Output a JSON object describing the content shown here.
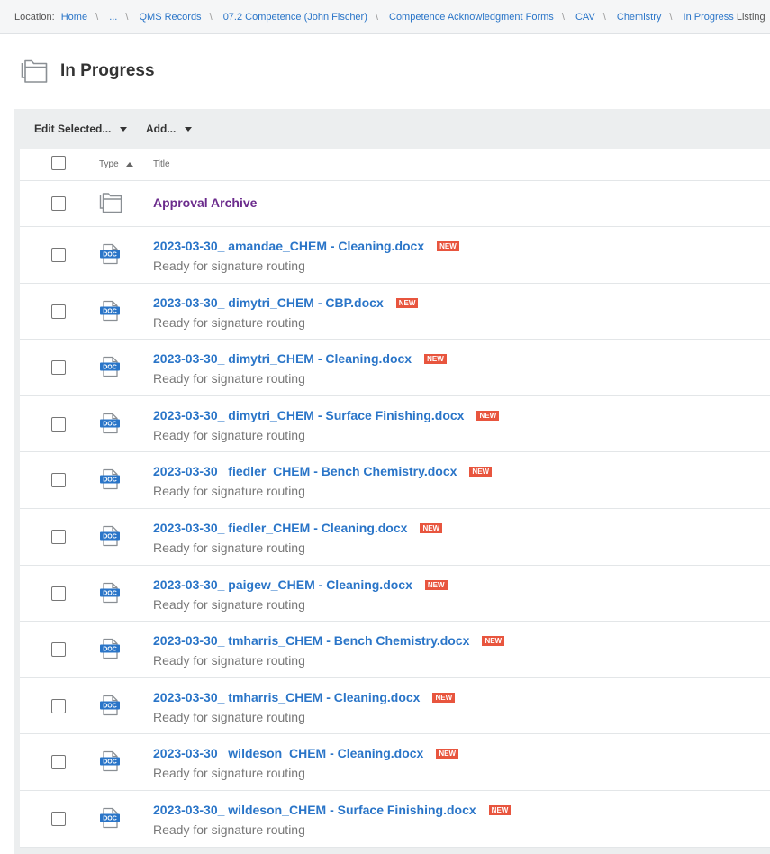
{
  "breadcrumb": {
    "label": "Location:",
    "items": [
      "Home",
      "...",
      "QMS Records",
      "07.2 Competence (John Fischer)",
      "Competence Acknowledgment Forms",
      "CAV",
      "Chemistry",
      "In Progress"
    ],
    "suffix": "Listing"
  },
  "page": {
    "title": "In Progress"
  },
  "toolbar": {
    "edit_selected": "Edit Selected...",
    "add": "Add..."
  },
  "table": {
    "headers": {
      "type": "Type",
      "title": "Title"
    },
    "folder": {
      "title": "Approval Archive",
      "icon": "folder-icon"
    },
    "new_badge": "NEW",
    "doc_icon_label": "DOC",
    "rows": [
      {
        "title": "2023-03-30_ amandae_CHEM - Cleaning.docx",
        "status": "Ready for signature routing"
      },
      {
        "title": "2023-03-30_ dimytri_CHEM - CBP.docx",
        "status": "Ready for signature routing"
      },
      {
        "title": "2023-03-30_ dimytri_CHEM - Cleaning.docx",
        "status": "Ready for signature routing"
      },
      {
        "title": "2023-03-30_ dimytri_CHEM - Surface Finishing.docx",
        "status": "Ready for signature routing"
      },
      {
        "title": "2023-03-30_ fiedler_CHEM - Bench Chemistry.docx",
        "status": "Ready for signature routing"
      },
      {
        "title": "2023-03-30_ fiedler_CHEM - Cleaning.docx",
        "status": "Ready for signature routing"
      },
      {
        "title": "2023-03-30_ paigew_CHEM - Cleaning.docx",
        "status": "Ready for signature routing"
      },
      {
        "title": "2023-03-30_ tmharris_CHEM - Bench Chemistry.docx",
        "status": "Ready for signature routing"
      },
      {
        "title": "2023-03-30_ tmharris_CHEM - Cleaning.docx",
        "status": "Ready for signature routing"
      },
      {
        "title": "2023-03-30_ wildeson_CHEM - Cleaning.docx",
        "status": "Ready for signature routing"
      },
      {
        "title": "2023-03-30_ wildeson_CHEM - Surface Finishing.docx",
        "status": "Ready for signature routing"
      }
    ]
  },
  "colors": {
    "link": "#2a75c8",
    "folder_link": "#6b2b8c",
    "badge": "#e8553e",
    "doc_icon": "#2a75c8"
  }
}
